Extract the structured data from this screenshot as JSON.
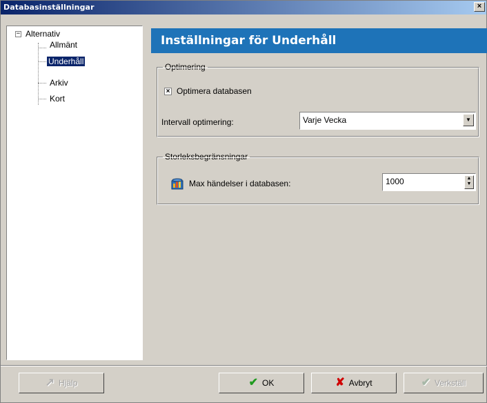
{
  "window": {
    "title": "Databasinställningar",
    "close_glyph": "×"
  },
  "tree": {
    "expander_glyph": "−",
    "root": "Alternativ",
    "items": [
      {
        "label": "Allmänt",
        "selected": false
      },
      {
        "label": "Underhåll",
        "selected": true
      },
      {
        "label": "Arkiv",
        "selected": false
      },
      {
        "label": "Kort",
        "selected": false
      }
    ]
  },
  "panel": {
    "title": "Inställningar för Underhåll",
    "optimize_group": {
      "legend": "Optimering",
      "checkbox_label": "Optimera databasen",
      "checked": true,
      "check_glyph": "×",
      "interval_label": "Intervall optimering:",
      "interval_value": "Varje Vecka",
      "dropdown_glyph": "▼"
    },
    "limits_group": {
      "legend": "Storleksbegränsningar",
      "max_label": "Max händelser i databasen:",
      "max_value": "1000",
      "spin_up_glyph": "▲",
      "spin_down_glyph": "▼",
      "icon": "database-chart-icon"
    }
  },
  "footer": {
    "help": {
      "label": "Hjälp",
      "icon": "help-arrow-icon",
      "glyph": "↗",
      "enabled": false
    },
    "ok": {
      "label": "OK",
      "icon": "green-check-icon",
      "glyph": "✔",
      "enabled": true
    },
    "cancel": {
      "label": "Avbryt",
      "icon": "red-x-icon",
      "glyph": "✘",
      "enabled": true
    },
    "apply": {
      "label": "Verkställ",
      "icon": "apply-check-icon",
      "glyph": "✔",
      "enabled": false
    }
  },
  "colors": {
    "title_bar": "#0a246a",
    "header_band": "#1e73b8",
    "selection": "#0a246a",
    "ok_green": "#1f9a1f",
    "cancel_red": "#d00000"
  }
}
